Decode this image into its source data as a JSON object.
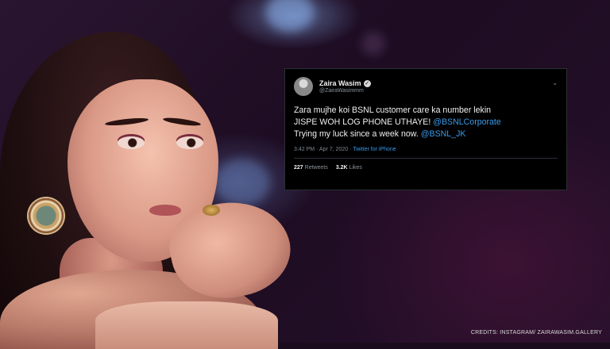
{
  "tweet": {
    "name": "Zaira Wasim",
    "handle": "@ZairaWasimmm",
    "verified_icon": "verified-badge-icon",
    "text_line1": "Zara mujhe koi BSNL customer care ka number lekin",
    "text_line2_a": "JISPE WOH LOG PHONE UTHAYE! ",
    "mention1": "@BSNLCorporate",
    "text_line3_a": "Trying my luck since a week now. ",
    "mention2": "@BSNL_JK",
    "timestamp": "3:42 PM · Apr 7, 2020 · ",
    "source": "Twitter for iPhone",
    "retweets_count": "227",
    "retweets_label": "Retweets",
    "likes_count": "3.2K",
    "likes_label": "Likes"
  },
  "credits": "CREDITS: INSTAGRAM/ ZAIRAWASIM.GALLERY",
  "colors": {
    "background": "#1a0c1c",
    "link": "#3a9ae8",
    "tweet_bg": "#000000"
  }
}
